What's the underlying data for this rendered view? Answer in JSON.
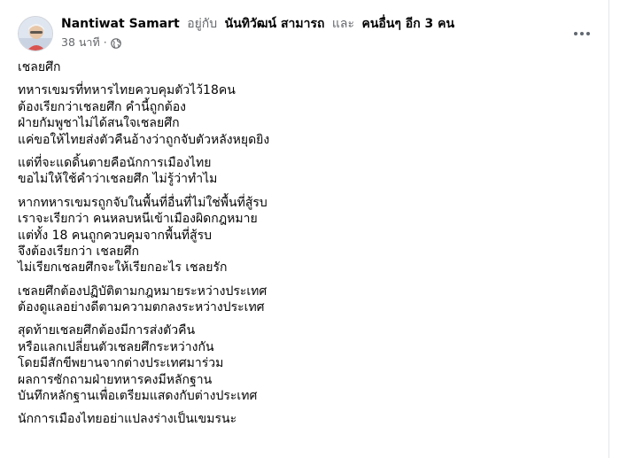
{
  "post": {
    "author": "Nantiwat Samart",
    "with_text": "อยู่กับ",
    "tagged_person": "นันทิวัฒน์ สามารถ",
    "and_text": "และ",
    "others_text": "คนอื่นๆ อีก 3 คน",
    "timestamp": "38 นาที",
    "separator": "·",
    "audience_icon": "globe-icon",
    "more_icon": "more-options-icon",
    "paragraphs": [
      [
        "เชลยศึก"
      ],
      [
        "ทหารเขมรที่ทหารไทยควบคุมตัวไว้18คน",
        "ต้องเรียกว่าเชลยศึก คำนี้ถูกต้อง",
        "ฝ่ายกัมพูชาไม่ได้สนใจเชลยศึก",
        "แค่ขอให้ไทยส่งตัวคืนอ้างว่าถูกจับตัวหลังหยุดยิง"
      ],
      [
        "แต่ที่จะแดดิ้นตายคือนักการเมืองไทย",
        "ขอไม่ให้ใช้คำว่าเชลยศึก ไม่รู้ว่าทำไม"
      ],
      [
        "หากทหารเขมรถูกจับในพื้นที่อื่นที่ไม่ใช่พื้นที่สู้รบ",
        "เราจะเรียกว่า คนหลบหนีเข้าเมืองผิดกฎหมาย",
        "แต่ทั้ง 18 คนถูกควบคุมจากพื้นที่สู้รบ",
        "จึงต้องเรียกว่า เชลยศึก",
        "ไม่เรียกเชลยศึกจะให้เรียกอะไร เชลยรัก"
      ],
      [
        "เชลยศึกต้องปฏิบัติตามกฎหมายระหว่างประเทศ",
        "ต้องดูแลอย่างดีตามความตกลงระหว่างประเทศ"
      ],
      [
        "สุดท้ายเชลยศึกต้องมีการส่งตัวคืน",
        "หรือแลกเปลี่ยนตัวเชลยศึกระหว่างกัน",
        "โดยมีสักขีพยานจากต่างประเทศมาร่วม",
        "ผลการซักถามฝ่ายทหารคงมีหลักฐาน",
        "บันทึกหลักฐานเพื่อเตรียมแสดงกับต่างประเทศ"
      ],
      [
        "นักการเมืองไทยอย่าแปลงร่างเป็นเขมรนะ"
      ]
    ]
  }
}
